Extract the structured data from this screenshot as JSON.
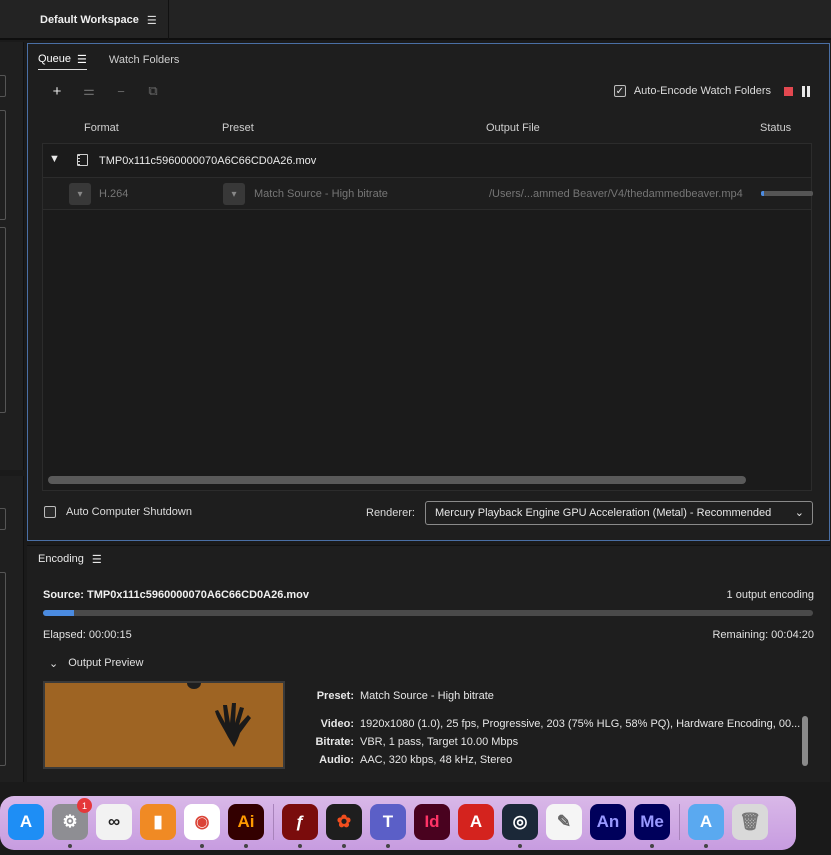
{
  "workspace": {
    "title": "Default Workspace",
    "menu_icon": "hamburger-icon"
  },
  "queue": {
    "tabs": [
      {
        "label": "Queue",
        "active": true
      },
      {
        "label": "Watch Folders",
        "active": false
      }
    ],
    "auto_encode_label": "Auto-Encode Watch Folders",
    "auto_encode_checked": true,
    "columns": {
      "format": "Format",
      "preset": "Preset",
      "output": "Output File",
      "status": "Status"
    },
    "source": {
      "name": "TMP0x111c5960000070A6C66CD0A26.mov"
    },
    "output": {
      "format": "H.264",
      "preset": "Match Source - High bitrate",
      "file": "/Users/...ammed Beaver/V4/thedammedbeaver.mp4",
      "progress": 0.06
    },
    "auto_shutdown_label": "Auto Computer Shutdown",
    "renderer_label": "Renderer:",
    "renderer_value": "Mercury Playback Engine GPU Acceleration (Metal) - Recommended"
  },
  "encoding": {
    "title": "Encoding",
    "source": "Source: TMP0x111c5960000070A6C66CD0A26.mov",
    "count": "1 output encoding",
    "progress": 0.04,
    "elapsed": "Elapsed: 00:00:15",
    "remaining": "Remaining: 00:04:20",
    "output_preview_label": "Output Preview",
    "details": [
      {
        "label": "Preset:",
        "value": "Match Source - High bitrate"
      },
      {
        "label": "Video:",
        "value": "1920x1080 (1.0), 25 fps, Progressive, 203 (75% HLG, 58% PQ), Hardware Encoding, 00..."
      },
      {
        "label": "Bitrate:",
        "value": "VBR, 1 pass, Target 10.00 Mbps"
      },
      {
        "label": "Audio:",
        "value": "AAC, 320 kbps, 48 kHz, Stereo"
      }
    ]
  },
  "dock": {
    "apps": [
      {
        "name": "app-store",
        "glyph": "A",
        "color": "#1e8ef5"
      },
      {
        "name": "system-settings",
        "glyph": "⚙",
        "color": "#8e8e93",
        "badge": "1"
      },
      {
        "name": "loop",
        "glyph": "∞",
        "color": "#f2f2f2"
      },
      {
        "name": "books",
        "glyph": "▮",
        "color": "#f08a24"
      },
      {
        "name": "chrome",
        "glyph": "◉",
        "color": "#ffffff"
      },
      {
        "name": "illustrator",
        "glyph": "Ai",
        "color": "#330000"
      },
      {
        "name": "flash",
        "glyph": "ƒ",
        "color": "#7a0c0c"
      },
      {
        "name": "figma",
        "glyph": "✿",
        "color": "#1e1e1e"
      },
      {
        "name": "teams",
        "glyph": "T",
        "color": "#5b5fc7"
      },
      {
        "name": "indesign",
        "glyph": "Id",
        "color": "#49021f"
      },
      {
        "name": "acrobat",
        "glyph": "A",
        "color": "#d4231e"
      },
      {
        "name": "steam",
        "glyph": "◎",
        "color": "#1b2838"
      },
      {
        "name": "textedit",
        "glyph": "✎",
        "color": "#f5f5f5"
      },
      {
        "name": "animate",
        "glyph": "An",
        "color": "#00005b"
      },
      {
        "name": "media-encoder",
        "glyph": "Me",
        "color": "#00005b"
      },
      {
        "name": "applications-folder",
        "glyph": "A",
        "color": "#5aa9f0"
      },
      {
        "name": "trash",
        "glyph": "🗑",
        "color": "#d9d9d9"
      }
    ]
  }
}
